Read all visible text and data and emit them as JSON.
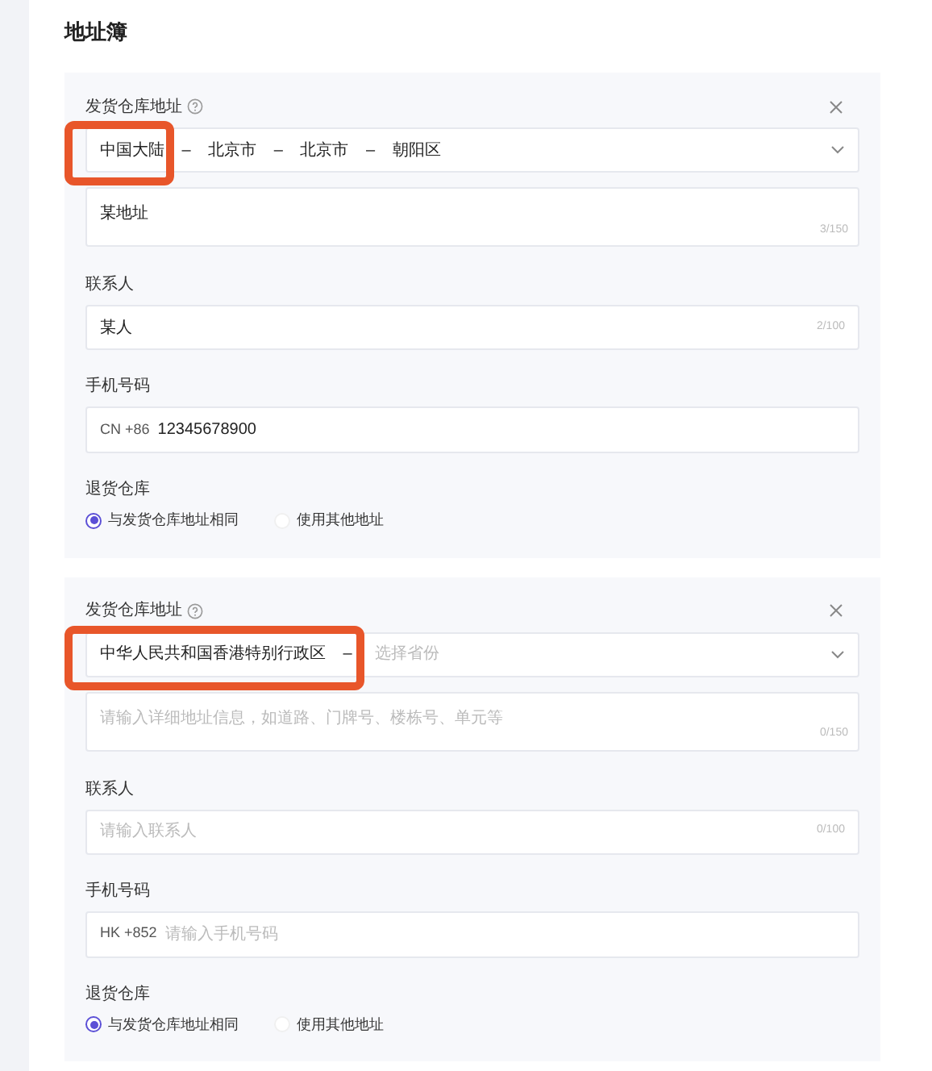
{
  "title": "地址簿",
  "addresses": [
    {
      "highlighted": true,
      "warehouse_label": "发货仓库地址",
      "region": {
        "value": "中国大陆 – 北京市 – 北京市 – 朝阳区"
      },
      "detail": {
        "value": "某地址",
        "counter": "3/150"
      },
      "contact_label": "联系人",
      "contact": {
        "value": "某人",
        "counter": "2/100"
      },
      "phone_label": "手机号码",
      "phone": {
        "prefix": "CN +86",
        "value": "12345678900"
      },
      "return_label": "退货仓库",
      "return_options": [
        {
          "label": "与发货仓库地址相同",
          "selected": true
        },
        {
          "label": "使用其他地址",
          "selected": false
        }
      ]
    },
    {
      "highlighted": true,
      "warehouse_label": "发货仓库地址",
      "region": {
        "value": "中华人民共和国香港特别行政区 –",
        "placeholder": "选择省份"
      },
      "detail": {
        "placeholder": "请输入详细地址信息，如道路、门牌号、楼栋号、单元等",
        "counter": "0/150"
      },
      "contact_label": "联系人",
      "contact": {
        "placeholder": "请输入联系人",
        "counter": "0/100"
      },
      "phone_label": "手机号码",
      "phone": {
        "prefix": "HK +852",
        "placeholder": "请输入手机号码"
      },
      "return_label": "退货仓库",
      "return_options": [
        {
          "label": "与发货仓库地址相同",
          "selected": true
        },
        {
          "label": "使用其他地址",
          "selected": false
        }
      ]
    }
  ]
}
